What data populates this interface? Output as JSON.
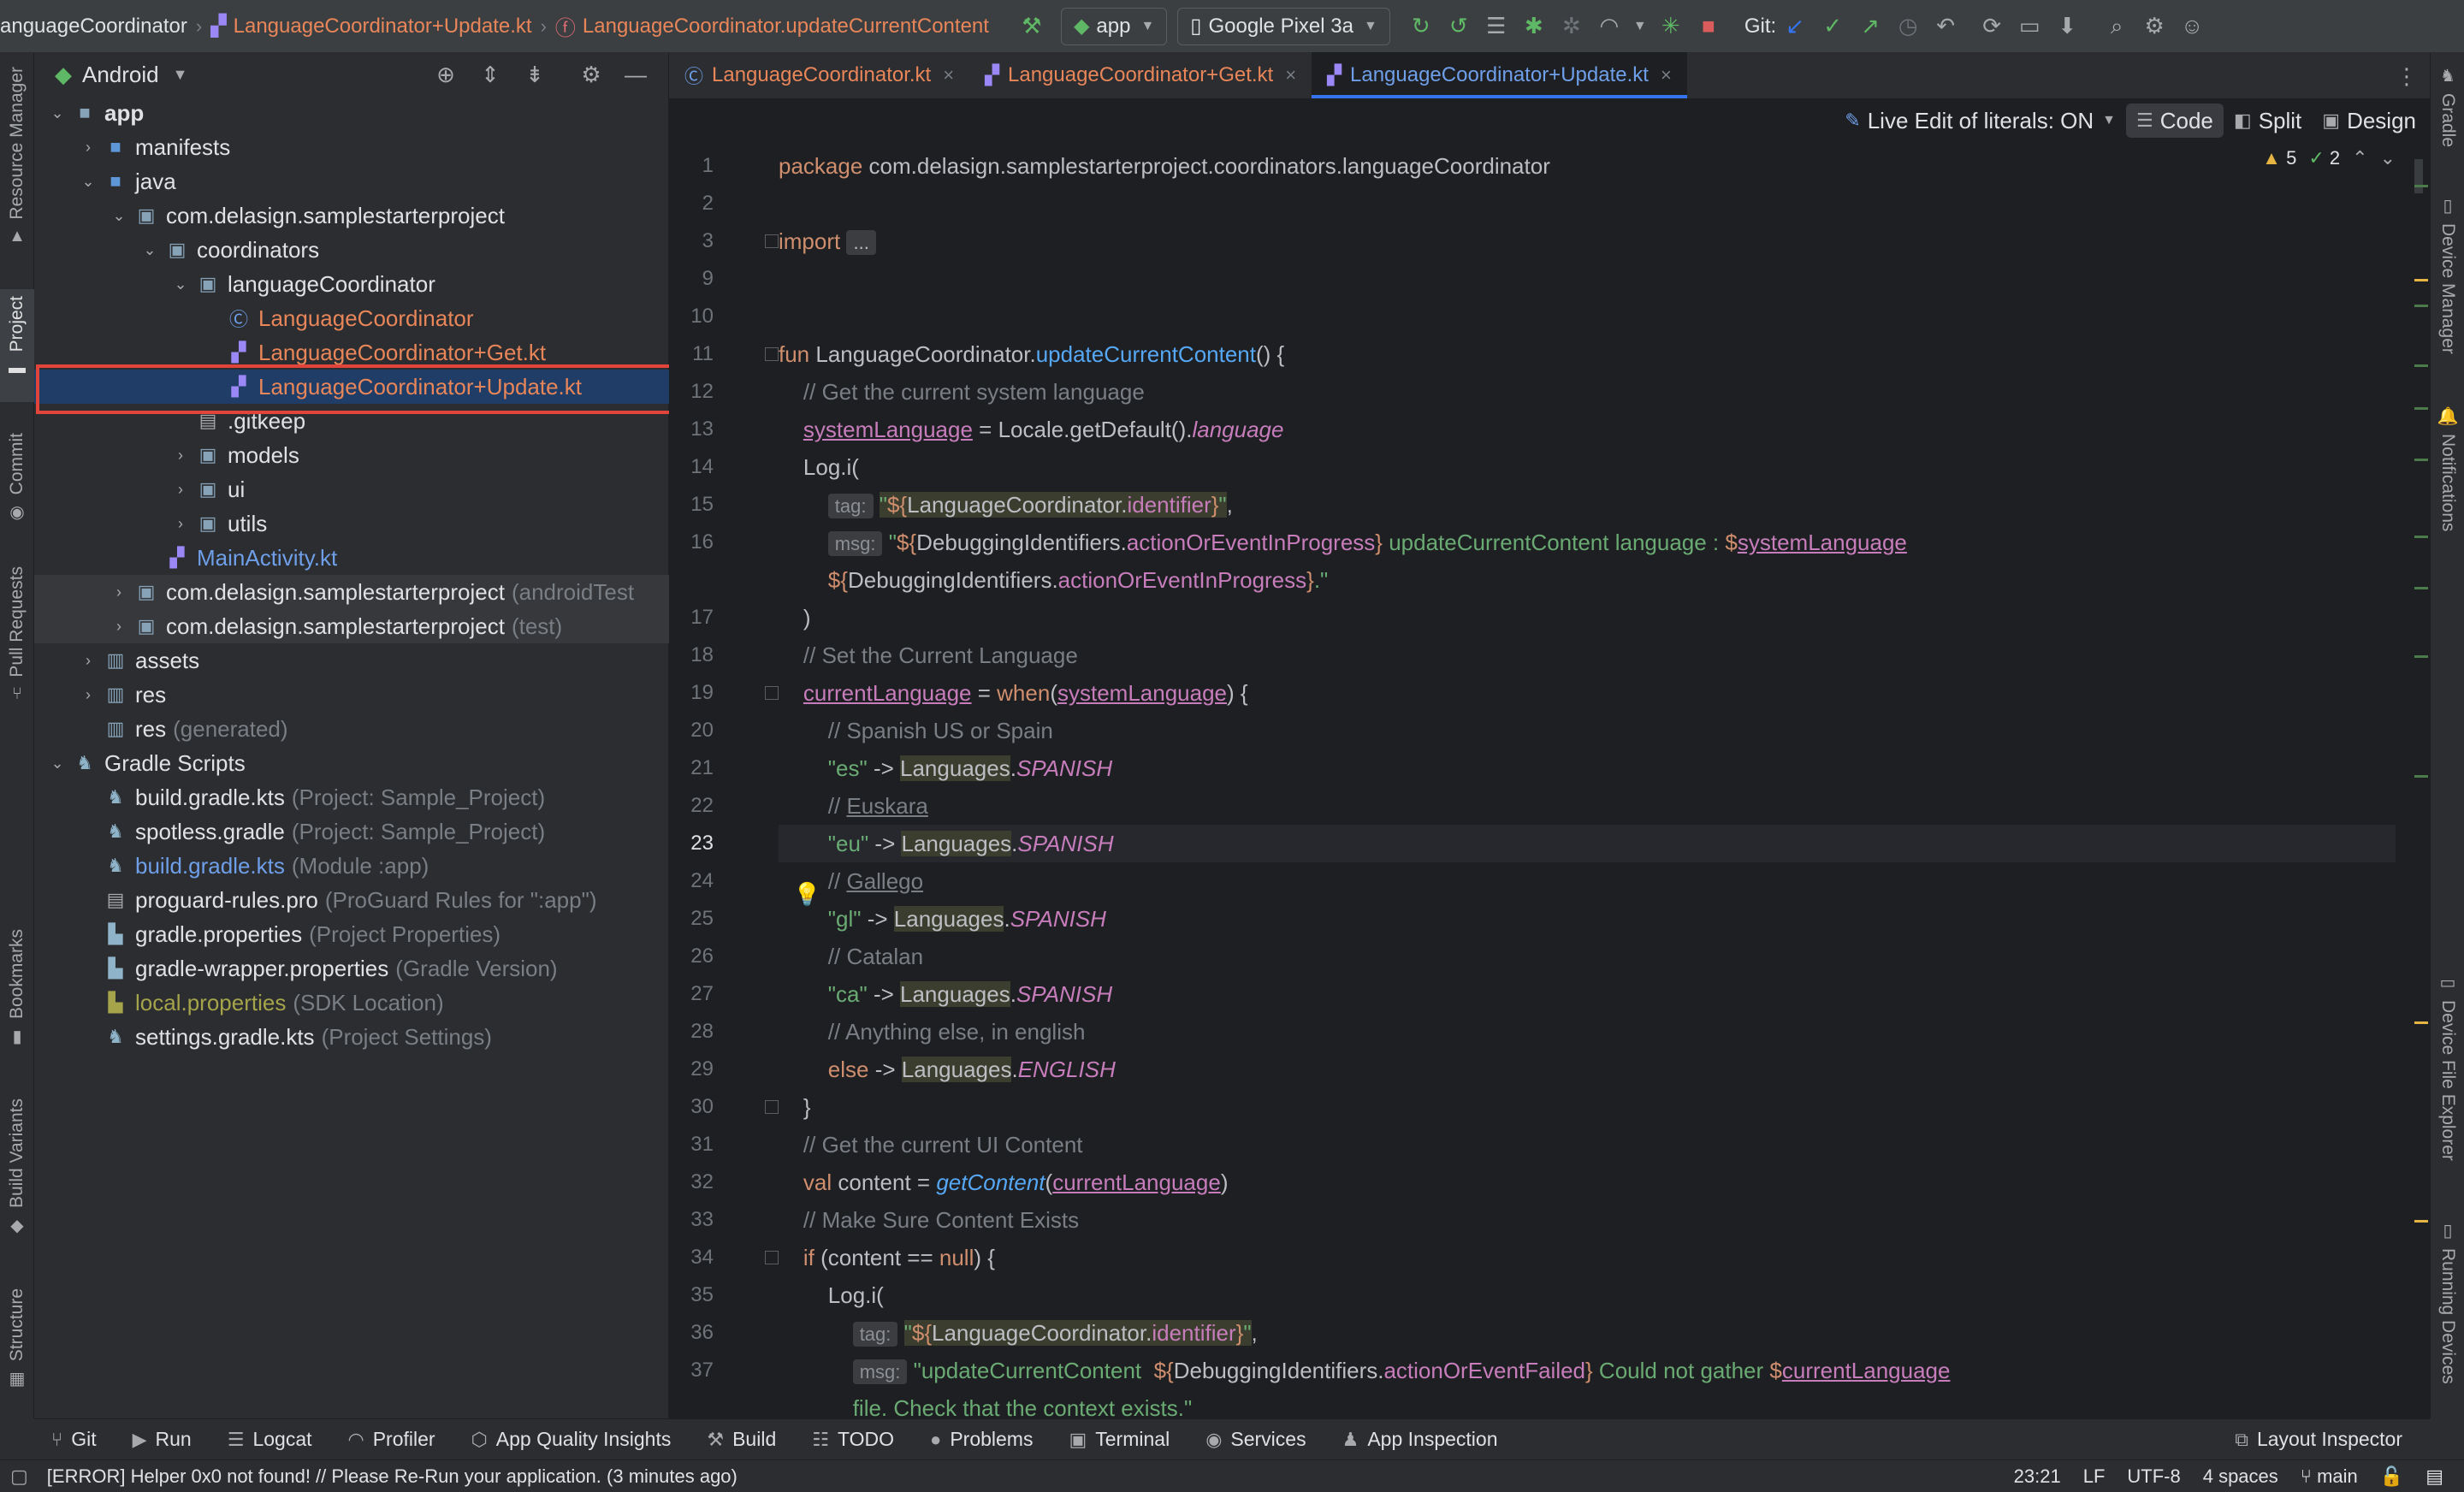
{
  "topbar": {
    "breadcrumbs": [
      "anguageCoordinator",
      "LanguageCoordinator+Update.kt",
      "LanguageCoordinator.updateCurrentContent"
    ],
    "run_config": "app",
    "device": "Google Pixel 3a",
    "git_label": "Git:"
  },
  "left_strip": [
    "Resource Manager",
    "Project",
    "Commit",
    "Pull Requests",
    "Bookmarks",
    "Build Variants",
    "Structure"
  ],
  "right_strip": [
    "Gradle",
    "Device Manager",
    "Notifications",
    "Device File Explorer",
    "Running Devices"
  ],
  "project": {
    "view": "Android",
    "tree": [
      {
        "label": "app",
        "hint": ""
      },
      {
        "label": "manifests",
        "hint": ""
      },
      {
        "label": "java",
        "hint": ""
      },
      {
        "label": "com.delasign.samplestarterproject",
        "hint": ""
      },
      {
        "label": "coordinators",
        "hint": ""
      },
      {
        "label": "languageCoordinator",
        "hint": ""
      },
      {
        "label": "LanguageCoordinator",
        "hint": ""
      },
      {
        "label": "LanguageCoordinator+Get.kt",
        "hint": ""
      },
      {
        "label": "LanguageCoordinator+Update.kt",
        "hint": ""
      },
      {
        "label": ".gitkeep",
        "hint": ""
      },
      {
        "label": "models",
        "hint": ""
      },
      {
        "label": "ui",
        "hint": ""
      },
      {
        "label": "utils",
        "hint": ""
      },
      {
        "label": "MainActivity.kt",
        "hint": ""
      },
      {
        "label": "com.delasign.samplestarterproject",
        "hint": "(androidTest"
      },
      {
        "label": "com.delasign.samplestarterproject",
        "hint": "(test)"
      },
      {
        "label": "assets",
        "hint": ""
      },
      {
        "label": "res",
        "hint": ""
      },
      {
        "label": "res",
        "hint": "(generated)"
      },
      {
        "label": "Gradle Scripts",
        "hint": ""
      },
      {
        "label": "build.gradle.kts",
        "hint": "(Project: Sample_Project)"
      },
      {
        "label": "spotless.gradle",
        "hint": "(Project: Sample_Project)"
      },
      {
        "label": "build.gradle.kts",
        "hint": "(Module :app)"
      },
      {
        "label": "proguard-rules.pro",
        "hint": "(ProGuard Rules for \":app\")"
      },
      {
        "label": "gradle.properties",
        "hint": "(Project Properties)"
      },
      {
        "label": "gradle-wrapper.properties",
        "hint": "(Gradle Version)"
      },
      {
        "label": "local.properties",
        "hint": "(SDK Location)"
      },
      {
        "label": "settings.gradle.kts",
        "hint": "(Project Settings)"
      }
    ]
  },
  "editor": {
    "tabs": [
      {
        "label": "LanguageCoordinator.kt"
      },
      {
        "label": "LanguageCoordinator+Get.kt"
      },
      {
        "label": "LanguageCoordinator+Update.kt"
      }
    ],
    "live_edit": "Live Edit of literals: ON",
    "view_modes": [
      "Code",
      "Split",
      "Design"
    ],
    "warnings": "5",
    "checks": "2",
    "line_numbers": [
      "1",
      "2",
      "3",
      "9",
      "10",
      "11",
      "12",
      "13",
      "14",
      "15",
      "16",
      "",
      "17",
      "18",
      "19",
      "20",
      "21",
      "22",
      "23",
      "24",
      "25",
      "26",
      "27",
      "28",
      "29",
      "30",
      "31",
      "32",
      "33",
      "34",
      "35",
      "36",
      "37",
      ""
    ],
    "current_line": "23"
  },
  "bottom_tools": [
    "Git",
    "Run",
    "Logcat",
    "Profiler",
    "App Quality Insights",
    "Build",
    "TODO",
    "Problems",
    "Terminal",
    "Services",
    "App Inspection"
  ],
  "bottom_right_tool": "Layout Inspector",
  "status": {
    "message": "[ERROR] Helper 0x0 not found! // Please Re-Run your application. (3 minutes ago)",
    "position": "23:21",
    "line_sep": "LF",
    "encoding": "UTF-8",
    "indent": "4 spaces",
    "branch": "main"
  },
  "colors": {
    "accent": "#3574f0",
    "selection_outline": "#e0443a",
    "keyword": "#cf8e6d",
    "string": "#6aab73",
    "comment": "#7a7e85",
    "function": "#56a8f5",
    "property": "#c77dbb"
  }
}
